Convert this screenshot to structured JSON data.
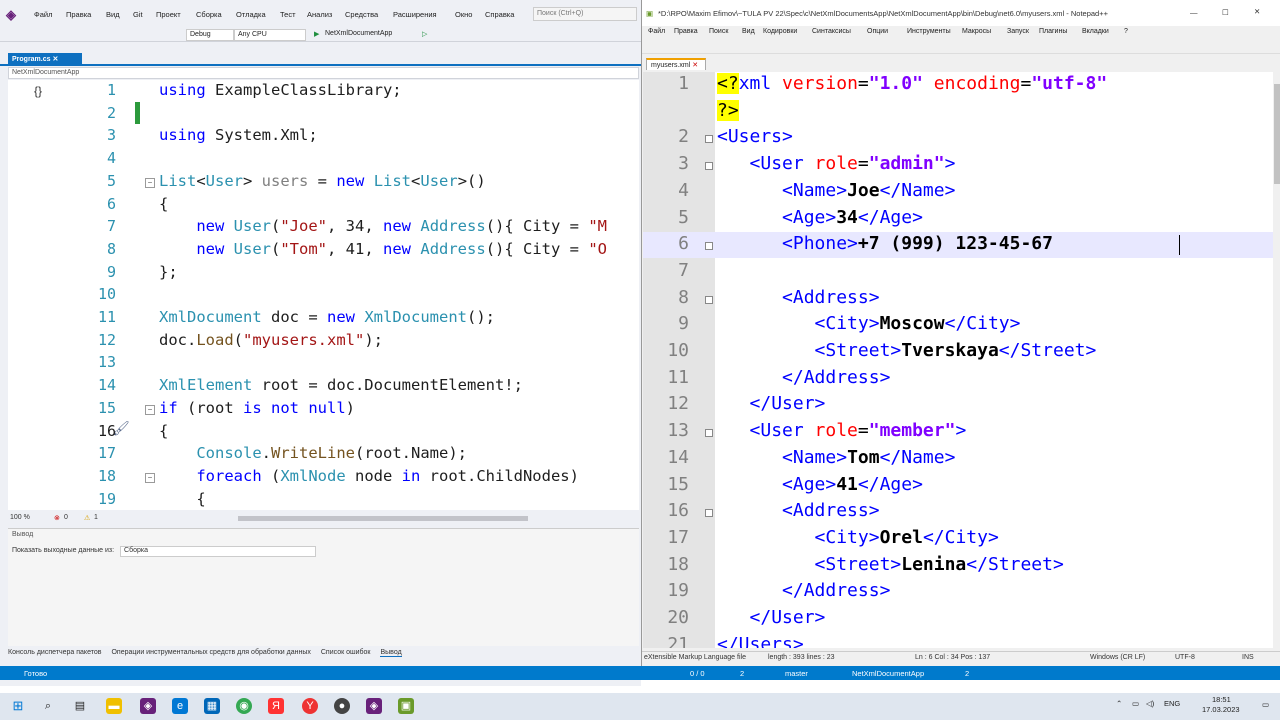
{
  "vs": {
    "menu": [
      "Файл",
      "Правка",
      "Вид",
      "Git",
      "Проект",
      "Сборка",
      "Отладка",
      "Тест",
      "Анализ",
      "Средства",
      "Расширения",
      "Окно",
      "Справка"
    ],
    "search_placeholder": "Поиск (Ctrl+Q)",
    "config": "Debug",
    "platform": "Any CPU",
    "run_label": "NetXmlDocumentApp",
    "tab_label": "Program.cs",
    "nav_project": "NetXmlDocumentApp",
    "code_lines": [
      {
        "n": "1",
        "html": "<span class='kw'>using</span> ExampleClassLibrary;"
      },
      {
        "n": "2",
        "html": ""
      },
      {
        "n": "3",
        "html": "<span class='kw'>using</span> System.Xml;"
      },
      {
        "n": "4",
        "html": ""
      },
      {
        "n": "5",
        "html": "<span class='ty'>List</span>&lt;<span class='ty'>User</span>&gt; <span class='gr'>users</span> = <span class='kw'>new</span> <span class='ty'>List</span>&lt;<span class='ty'>User</span>&gt;()"
      },
      {
        "n": "6",
        "html": "{"
      },
      {
        "n": "7",
        "html": "    <span class='kw'>new</span> <span class='ty'>User</span>(<span class='st'>\"Joe\"</span>, 34, <span class='kw'>new</span> <span class='ty'>Address</span>(){ City = <span class='st'>\"M</span>"
      },
      {
        "n": "8",
        "html": "    <span class='kw'>new</span> <span class='ty'>User</span>(<span class='st'>\"Tom\"</span>, 41, <span class='kw'>new</span> <span class='ty'>Address</span>(){ City = <span class='st'>\"O</span>"
      },
      {
        "n": "9",
        "html": "};"
      },
      {
        "n": "10",
        "html": ""
      },
      {
        "n": "11",
        "html": "<span class='ty'>XmlDocument</span> doc = <span class='kw'>new</span> <span class='ty'>XmlDocument</span>();"
      },
      {
        "n": "12",
        "html": "doc.<span class='fn'>Load</span>(<span class='st'>\"myusers.xml\"</span>);"
      },
      {
        "n": "13",
        "html": ""
      },
      {
        "n": "14",
        "html": "<span class='ty'>XmlElement</span> root = doc.DocumentElement!;"
      },
      {
        "n": "15",
        "html": "<span class='kw'>if</span> (root <span class='kw'>is not null</span>)"
      },
      {
        "n": "16",
        "html": "{"
      },
      {
        "n": "17",
        "html": "    <span class='ty'>Console</span>.<span class='fn'>WriteLine</span>(root.Name);"
      },
      {
        "n": "18",
        "html": "    <span class='kw'>foreach</span> (<span class='ty'>XmlNode</span> node <span class='kw'>in</span> root.ChildNodes)"
      },
      {
        "n": "19",
        "html": "    {"
      }
    ],
    "zoom": "100 %",
    "errors": "0",
    "warnings": "1",
    "output_title": "Вывод",
    "output_label": "Показать выходные данные из:",
    "output_source": "Сборка",
    "bottom_tabs": [
      "Консоль диспетчера пакетов",
      "Операции инструментальных средств для обработки данных",
      "Список ошибок",
      "Вывод"
    ],
    "status_ready": "Готово",
    "status_right": [
      "0 / 0",
      "2",
      "master",
      "NetXmlDocumentApp",
      "2"
    ]
  },
  "np": {
    "title": "*D:\\RPO\\Maxim Efimov\\~TULA PV 22\\Spec\\c\\NetXmlDocumentsApp\\NetXmlDocumentApp\\bin\\Debug\\net6.0\\myusers.xml - Notepad++",
    "menu": [
      "Файл",
      "Правка",
      "Поиск",
      "Вид",
      "Кодировки",
      "Синтаксисы",
      "Опции",
      "Инструменты",
      "Макросы",
      "Запуск",
      "Плагины",
      "Вкладки",
      "?"
    ],
    "tab_label": "myusers.xml",
    "lines": [
      {
        "n": "1",
        "html": "<span style='background:#ffff00'>&lt;?</span><span class='tg'>xml</span> <span class='an'>version</span>=<span class='av'>\"1.0\"</span> <span class='an'>encoding</span>=<span class='av'>\"utf-8\"</span>"
      },
      {
        "n": "",
        "html": "<span style='background:#ffff00'>?&gt;</span>"
      },
      {
        "n": "2",
        "html": "<span class='tg'>&lt;Users&gt;</span>"
      },
      {
        "n": "3",
        "html": "   <span class='tg'>&lt;User</span> <span class='an'>role</span>=<span class='av'>\"admin\"</span><span class='tg'>&gt;</span>"
      },
      {
        "n": "4",
        "html": "      <span class='tg'>&lt;Name&gt;</span><span class='tx'>Joe</span><span class='tg'>&lt;/Name&gt;</span>"
      },
      {
        "n": "5",
        "html": "      <span class='tg'>&lt;Age&gt;</span><span class='tx'>34</span><span class='tg'>&lt;/Age&gt;</span>"
      },
      {
        "n": "6",
        "html": "      <span class='tg'>&lt;Phone&gt;</span><span class='tx'>+7 (999) 123-45-67</span>"
      },
      {
        "n": "7",
        "html": ""
      },
      {
        "n": "8",
        "html": "      <span class='tg'>&lt;Address&gt;</span>"
      },
      {
        "n": "9",
        "html": "         <span class='tg'>&lt;City&gt;</span><span class='tx'>Moscow</span><span class='tg'>&lt;/City&gt;</span>"
      },
      {
        "n": "10",
        "html": "         <span class='tg'>&lt;Street&gt;</span><span class='tx'>Tverskaya</span><span class='tg'>&lt;/Street&gt;</span>"
      },
      {
        "n": "11",
        "html": "      <span class='tg'>&lt;/Address&gt;</span>"
      },
      {
        "n": "12",
        "html": "   <span class='tg'>&lt;/User&gt;</span>"
      },
      {
        "n": "13",
        "html": "   <span class='tg'>&lt;User</span> <span class='an'>role</span>=<span class='av'>\"member\"</span><span class='tg'>&gt;</span>"
      },
      {
        "n": "14",
        "html": "      <span class='tg'>&lt;Name&gt;</span><span class='tx'>Tom</span><span class='tg'>&lt;/Name&gt;</span>"
      },
      {
        "n": "15",
        "html": "      <span class='tg'>&lt;Age&gt;</span><span class='tx'>41</span><span class='tg'>&lt;/Age&gt;</span>"
      },
      {
        "n": "16",
        "html": "      <span class='tg'>&lt;Address&gt;</span>"
      },
      {
        "n": "17",
        "html": "         <span class='tg'>&lt;City&gt;</span><span class='tx'>Orel</span><span class='tg'>&lt;/City&gt;</span>"
      },
      {
        "n": "18",
        "html": "         <span class='tg'>&lt;Street&gt;</span><span class='tx'>Lenina</span><span class='tg'>&lt;/Street&gt;</span>"
      },
      {
        "n": "19",
        "html": "      <span class='tg'>&lt;/Address&gt;</span>"
      },
      {
        "n": "20",
        "html": "   <span class='tg'>&lt;/User&gt;</span>"
      },
      {
        "n": "21",
        "html": "<span class='tg'>&lt;/Users&gt;</span>"
      }
    ],
    "status": {
      "lang": "eXtensible Markup Language file",
      "length": "length : 393   lines : 23",
      "pos": "Ln : 6   Col : 34   Pos : 137",
      "eol": "Windows (CR LF)",
      "enc": "UTF-8",
      "mode": "INS"
    }
  },
  "taskbar": {
    "lang": "ENG",
    "time": "18:51",
    "date": "17.03.2023"
  }
}
